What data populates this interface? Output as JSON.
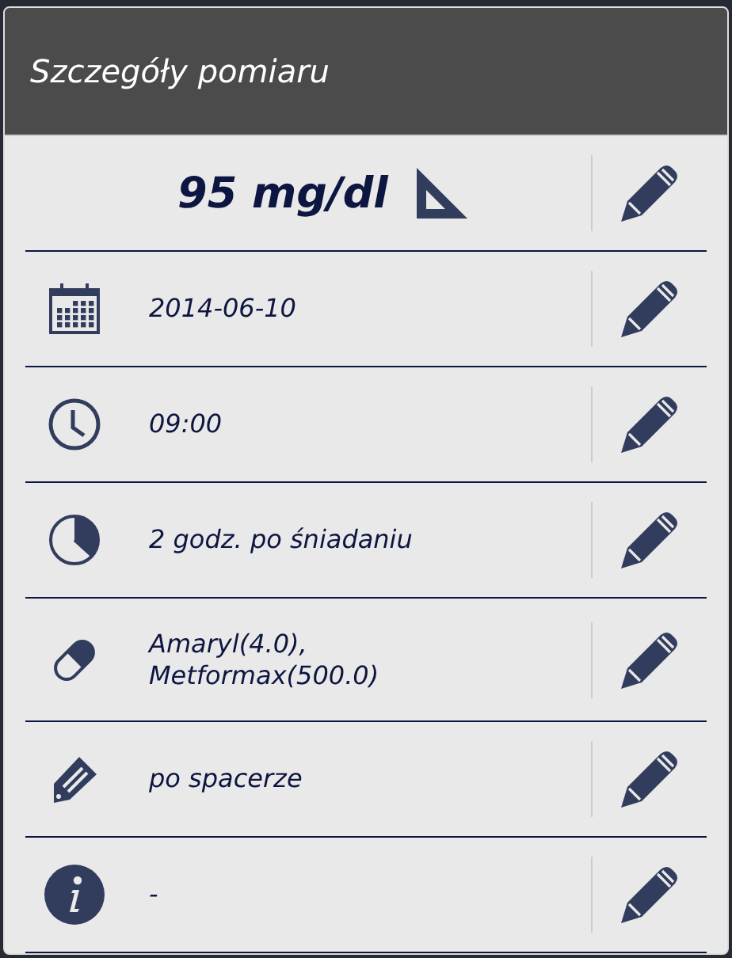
{
  "dialog": {
    "title": "Szczegóły pomiaru"
  },
  "rows": [
    {
      "kind": "value",
      "text": "95 mg/dl"
    },
    {
      "kind": "date",
      "text": "2014-06-10"
    },
    {
      "kind": "time",
      "text": "09:00"
    },
    {
      "kind": "meal",
      "text": "2 godz. po śniadaniu"
    },
    {
      "kind": "medication",
      "text": "Amaryl(4.0),\nMetformax(500.0)"
    },
    {
      "kind": "note",
      "text": "po spacerze"
    },
    {
      "kind": "info",
      "text": "-"
    }
  ]
}
